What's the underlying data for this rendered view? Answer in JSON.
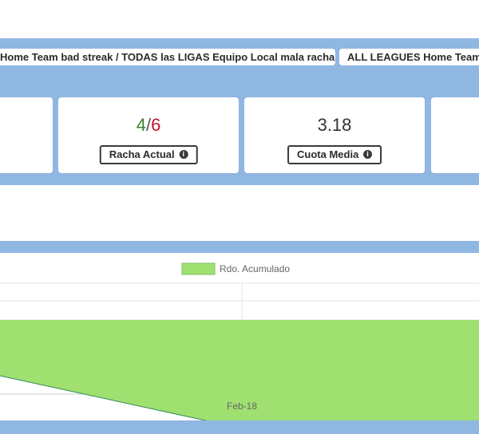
{
  "tabs": [
    {
      "label": "Home Team bad streak / TODAS las LIGAS Equipo Local mala racha"
    },
    {
      "label": "ALL LEAGUES Home Team"
    }
  ],
  "stats": {
    "streak": {
      "current": "4",
      "separator": "/",
      "max": "6",
      "label": "Racha Actual"
    },
    "avg_odds": {
      "value": "3.18",
      "label": "Cuota Media"
    }
  },
  "icons": {
    "info": "info-icon"
  },
  "colors": {
    "band": "#90b6e2",
    "green": "#3f7f2f",
    "red": "#c8102e",
    "area_fill": "#9fe070",
    "area_line": "#2e8b57"
  },
  "chart_data": {
    "type": "area",
    "legend": [
      "Rdo. Acumulado"
    ],
    "legend_position": "top",
    "x_tick_labels": [
      "Feb-18"
    ],
    "series": [
      {
        "name": "Rdo. Acumulado",
        "x": [
          "",
          "Feb-18",
          ""
        ],
        "values": [
          -0.35,
          -0.68,
          -0.76
        ]
      }
    ],
    "grid": true
  }
}
